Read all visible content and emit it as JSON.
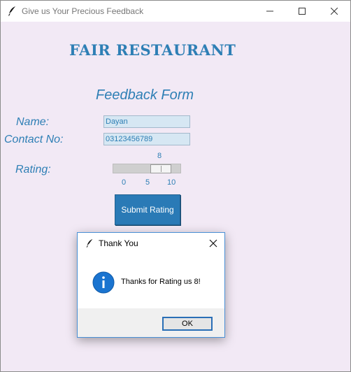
{
  "window": {
    "title": "Give us Your Precious Feedback",
    "buttons": [
      "minimize",
      "maximize",
      "close"
    ]
  },
  "app": {
    "heading": "FAIR RESTAURANT",
    "form_title": "Feedback Form",
    "name_label": "Name:",
    "name_value": "Dayan",
    "contact_label": "Contact No:",
    "contact_value": "03123456789",
    "rating_label": "Rating:",
    "rating": {
      "value": "8",
      "min": 0,
      "max": 10,
      "ticks": [
        "0",
        "5",
        "10"
      ]
    },
    "submit_label": "Submit Rating"
  },
  "dialog": {
    "title": "Thank You",
    "message": "Thanks for Rating us 8!",
    "ok_label": "OK",
    "icon": "info-icon"
  },
  "colors": {
    "background": "#f2e9f5",
    "accent": "#2e7fb5",
    "button": "#2a7ab6",
    "entry": "#d6e7f3"
  }
}
